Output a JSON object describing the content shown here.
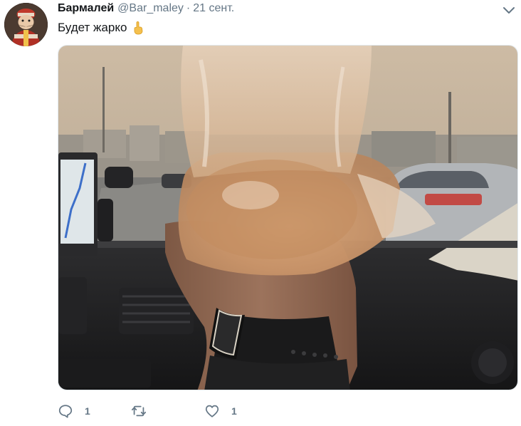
{
  "tweet": {
    "author_name": "Бармалей",
    "author_handle": "@Bar_maley",
    "separator": "·",
    "timestamp": "21 сент.",
    "text": "Будет жарко",
    "emoji": "pointing-up-emoji",
    "avatar_icon": "avatar-image",
    "menu_icon": "chevron-down-icon"
  },
  "actions": {
    "reply": {
      "icon": "reply-icon",
      "count": "1"
    },
    "retweet": {
      "icon": "retweet-icon",
      "count": ""
    },
    "like": {
      "icon": "heart-icon",
      "count": "1"
    }
  },
  "media": {
    "icon": "tweet-photo",
    "description_color": "#a87a4e"
  },
  "colors": {
    "text_primary": "#14171a",
    "text_secondary": "#657786",
    "border": "#e1e8ed"
  }
}
